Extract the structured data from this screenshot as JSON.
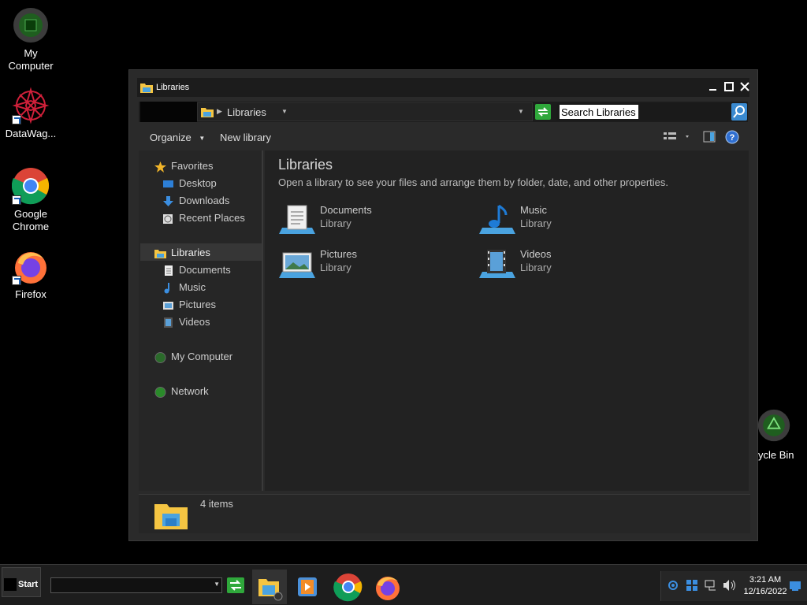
{
  "desktop": {
    "icons": [
      {
        "label": "My Computer"
      },
      {
        "label": "DataWag..."
      },
      {
        "label": "Google Chrome"
      },
      {
        "label": "Firefox"
      },
      {
        "label": "ycle Bin"
      }
    ]
  },
  "window": {
    "title": "Libraries",
    "address": {
      "crumb": "Libraries"
    },
    "search": {
      "placeholder": "Search Libraries"
    },
    "toolbar": {
      "organize": "Organize",
      "new_library": "New library"
    },
    "nav": {
      "favorites": "Favorites",
      "desktop": "Desktop",
      "downloads": "Downloads",
      "recent": "Recent Places",
      "libraries": "Libraries",
      "documents": "Documents",
      "music": "Music",
      "pictures": "Pictures",
      "videos": "Videos",
      "computer": "My Computer",
      "network": "Network"
    },
    "content": {
      "heading": "Libraries",
      "description": "Open a library to see your files and arrange them by folder, date, and other properties.",
      "items": [
        {
          "name": "Documents",
          "type": "Library"
        },
        {
          "name": "Music",
          "type": "Library"
        },
        {
          "name": "Pictures",
          "type": "Library"
        },
        {
          "name": "Videos",
          "type": "Library"
        }
      ]
    },
    "details": {
      "count": "4 items"
    }
  },
  "taskbar": {
    "start": "Start",
    "clock": {
      "time": "3:21 AM",
      "date": "12/16/2022"
    }
  }
}
